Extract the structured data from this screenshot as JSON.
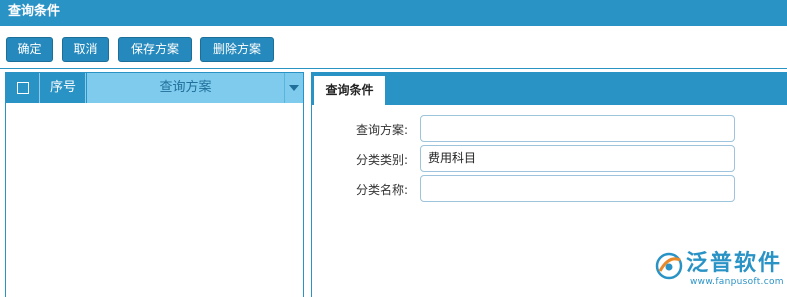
{
  "window": {
    "title": "查询条件"
  },
  "toolbar": {
    "buttons": [
      {
        "label": "确定"
      },
      {
        "label": "取消"
      },
      {
        "label": "保存方案"
      },
      {
        "label": "删除方案"
      }
    ]
  },
  "grid": {
    "columns": {
      "seq": "序号",
      "plan": "查询方案"
    },
    "rows": []
  },
  "form": {
    "tab": "查询条件",
    "fields": [
      {
        "label": "查询方案:",
        "value": ""
      },
      {
        "label": "分类类别:",
        "value": "费用科目"
      },
      {
        "label": "分类名称:",
        "value": ""
      }
    ]
  },
  "logo": {
    "name": "泛普软件",
    "url": "www.fanpusoft.com"
  },
  "colors": {
    "accent": "#2a93c6",
    "button": "#2589bd",
    "header_light": "#7fcbee"
  }
}
